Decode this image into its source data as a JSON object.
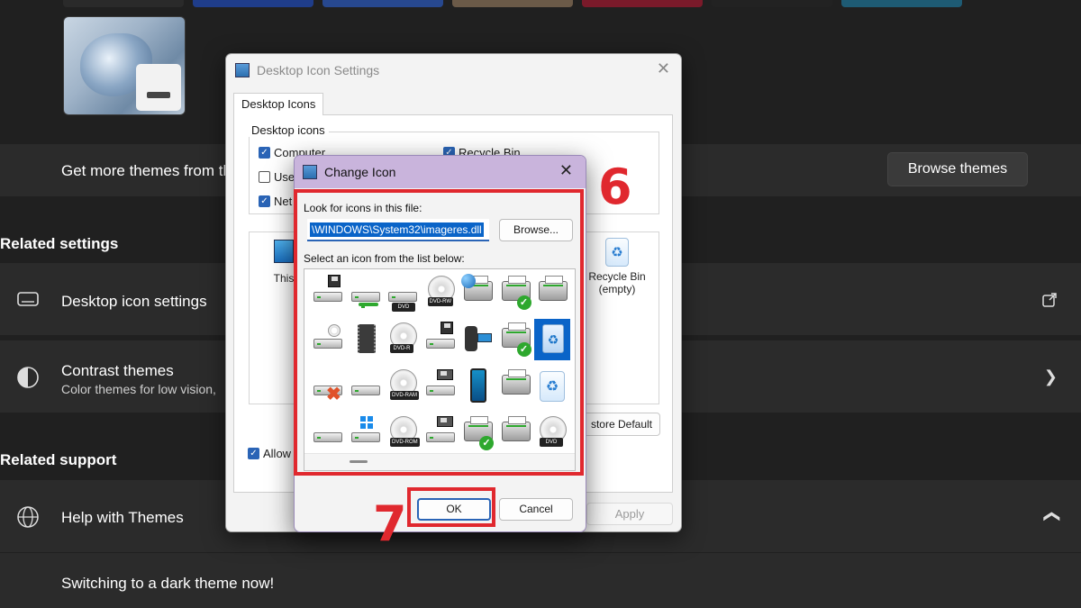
{
  "settings": {
    "get_more_themes": "Get more themes from th",
    "browse_themes": "Browse themes",
    "related_settings": "Related settings",
    "desktop_icon_settings": "Desktop icon settings",
    "contrast_themes": "Contrast themes",
    "contrast_sub": "Color themes for low vision,",
    "related_support": "Related support",
    "help_with_themes": "Help with Themes",
    "switching": "Switching to a dark theme now!"
  },
  "desktop_icon_dialog": {
    "title": "Desktop Icon Settings",
    "tab": "Desktop Icons",
    "group_title": "Desktop icons",
    "checkboxes": [
      {
        "label": "Computer",
        "checked": true
      },
      {
        "label": "Use",
        "checked": false
      },
      {
        "label": "Net",
        "checked": true
      },
      {
        "label": "Recycle Bin",
        "checked": true
      }
    ],
    "preview_this_pc": "This",
    "preview_bin_line1": "Recycle Bin",
    "preview_bin_line2": "(empty)",
    "restore_default": "store Default",
    "allow_label": "Allow",
    "apply": "Apply"
  },
  "change_icon_dialog": {
    "title": "Change Icon",
    "look_for_label": "Look for icons in this file:",
    "file_path": "\\WINDOWS\\System32\\imageres.dll",
    "browse": "Browse...",
    "select_label": "Select an icon from the list below:",
    "ok": "OK",
    "cancel": "Cancel",
    "icons": [
      {
        "name": "floppy-drive-icon",
        "kind": "drive",
        "extra": "floppy"
      },
      {
        "name": "removable-drive-icon",
        "kind": "drive",
        "extra": "green"
      },
      {
        "name": "dvd-drive-icon",
        "kind": "drive",
        "tag": "DVD"
      },
      {
        "name": "dvd-rw-disc-icon",
        "kind": "disc",
        "tag": "DVD-RW"
      },
      {
        "name": "network-printer-icon",
        "kind": "printer",
        "extra": "globe"
      },
      {
        "name": "default-printer-icon",
        "kind": "printer",
        "extra": "check"
      },
      {
        "name": "printer-icon",
        "kind": "printer"
      },
      {
        "name": "cd-drive-icon",
        "kind": "drive",
        "extra": "disc"
      },
      {
        "name": "memory-chip-icon",
        "kind": "chip"
      },
      {
        "name": "dvd-r-disc-icon",
        "kind": "disc",
        "tag": "DVD-R"
      },
      {
        "name": "floppy-drive-2-icon",
        "kind": "drive",
        "extra": "floppy"
      },
      {
        "name": "webcam-icon",
        "kind": "camera"
      },
      {
        "name": "printer-check-icon",
        "kind": "printer",
        "extra": "check"
      },
      {
        "name": "recycle-bin-full-icon",
        "kind": "bin",
        "selected": true
      },
      {
        "name": "drive-error-icon",
        "kind": "drive",
        "extra": "x"
      },
      {
        "name": "hard-drive-icon",
        "kind": "drive"
      },
      {
        "name": "dvd-ram-disc-icon",
        "kind": "disc",
        "tag": "DVD-RAM"
      },
      {
        "name": "network-drive-icon",
        "kind": "drive",
        "extra": "box"
      },
      {
        "name": "mobile-phone-icon",
        "kind": "phone"
      },
      {
        "name": "fax-printer-icon",
        "kind": "printer"
      },
      {
        "name": "recycle-bin-empty-icon",
        "kind": "minibin"
      },
      {
        "name": "external-drive-icon",
        "kind": "drive"
      },
      {
        "name": "windows-drive-icon",
        "kind": "drive",
        "extra": "win"
      },
      {
        "name": "dvd-rom-disc-icon",
        "kind": "disc",
        "tag": "DVD-ROM"
      },
      {
        "name": "network-storage-icon",
        "kind": "drive",
        "extra": "box"
      },
      {
        "name": "printer-floppy-check-icon",
        "kind": "printer",
        "extra": "check"
      },
      {
        "name": "printer-floppy-icon",
        "kind": "printer"
      },
      {
        "name": "dvd-disc-icon",
        "kind": "disc",
        "tag": "DVD"
      }
    ]
  },
  "annotations": {
    "step6": "6",
    "step7": "7"
  },
  "colors": {
    "accent": "#2a64b6",
    "selection": "#0a64c8",
    "annotation_red": "#e0282e",
    "dialog_titlebar": "#c9b4dc"
  }
}
